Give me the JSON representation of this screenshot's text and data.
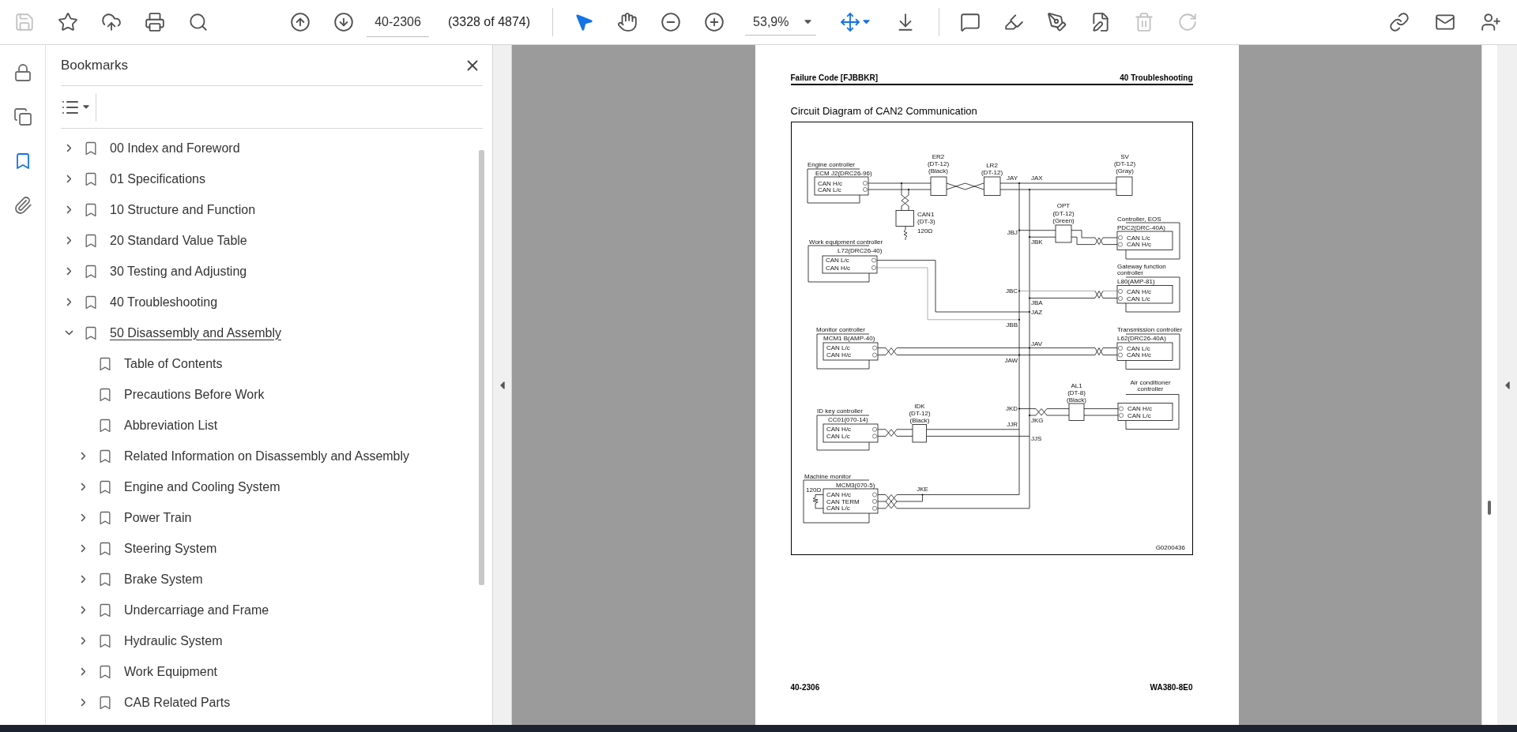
{
  "toolbar": {
    "tools": [
      {
        "disabled": true
      },
      {
        "disabled": false
      },
      {
        "disabled": false
      },
      {
        "disabled": false
      },
      {
        "disabled": false
      },
      {
        "disabled": false
      },
      {
        "disabled": false
      },
      {
        "disabled": false
      },
      {
        "disabled": false
      },
      {
        "disabled": false
      },
      {
        "disabled": false
      },
      {
        "disabled": false
      },
      {
        "disabled": false
      },
      {
        "disabled": false
      },
      {
        "disabled": false
      },
      {
        "disabled": true
      },
      {
        "disabled": true
      },
      {
        "disabled": false
      },
      {
        "disabled": false
      },
      {
        "disabled": false
      }
    ],
    "mode_tools": [
      {
        "selected": true
      },
      {
        "selected": false
      }
    ],
    "page_field": {
      "value": "40-2306"
    },
    "page_count": "(3328 of 4874)",
    "zoom_field": {
      "value": "53,9%"
    }
  },
  "side_rail": [
    {
      "selected": false
    },
    {
      "selected": false
    },
    {
      "selected": true
    },
    {
      "selected": false
    }
  ],
  "bookmarks": {
    "title": "Bookmarks",
    "items": [
      {
        "label": "00 Index and Foreword",
        "expandable": true,
        "expanded": false,
        "selected": false
      },
      {
        "label": "01 Specifications",
        "expandable": true,
        "expanded": false,
        "selected": false
      },
      {
        "label": "10 Structure and Function",
        "expandable": true,
        "expanded": false,
        "selected": false
      },
      {
        "label": "20 Standard Value Table",
        "expandable": true,
        "expanded": false,
        "selected": false
      },
      {
        "label": "30 Testing and Adjusting",
        "expandable": true,
        "expanded": false,
        "selected": false
      },
      {
        "label": "40 Troubleshooting",
        "expandable": true,
        "expanded": false,
        "selected": false
      },
      {
        "label": "50 Disassembly and Assembly",
        "expandable": true,
        "expanded": true,
        "selected": true,
        "children": [
          {
            "label": "Table of Contents",
            "expandable": false,
            "expanded": false,
            "selected": false
          },
          {
            "label": "Precautions Before Work",
            "expandable": false,
            "expanded": false,
            "selected": false
          },
          {
            "label": "Abbreviation List",
            "expandable": false,
            "expanded": false,
            "selected": false
          },
          {
            "label": "Related Information on Disassembly and Assembly",
            "expandable": true,
            "expanded": false,
            "selected": false
          },
          {
            "label": "Engine and Cooling System",
            "expandable": true,
            "expanded": false,
            "selected": false
          },
          {
            "label": "Power Train",
            "expandable": true,
            "expanded": false,
            "selected": false
          },
          {
            "label": "Steering System",
            "expandable": true,
            "expanded": false,
            "selected": false
          },
          {
            "label": "Brake System",
            "expandable": true,
            "expanded": false,
            "selected": false
          },
          {
            "label": "Undercarriage and Frame",
            "expandable": true,
            "expanded": false,
            "selected": false
          },
          {
            "label": "Hydraulic System",
            "expandable": true,
            "expanded": false,
            "selected": false
          },
          {
            "label": "Work Equipment",
            "expandable": true,
            "expanded": false,
            "selected": false
          },
          {
            "label": "CAB Related Parts",
            "expandable": true,
            "expanded": false,
            "selected": false
          }
        ]
      }
    ]
  },
  "page": {
    "header_left": "Failure Code [FJBBKR]",
    "header_right": "40 Troubleshooting",
    "title": "Circuit Diagram of CAN2 Communication",
    "diagram": {
      "devices": [
        {
          "title": [
            "Engine controller"
          ],
          "connector": "ECM J2(DRC26-96)",
          "lines": [
            "CAN H/c",
            "CAN L/c"
          ]
        },
        {
          "title": [
            "Work equipment controller"
          ],
          "connector": "L72(DRC26-40)",
          "lines": [
            "CAN L/c",
            "CAN H/c"
          ]
        },
        {
          "title": [
            "Monitor controller"
          ],
          "connector": "MCM1 B(AMP-40)",
          "lines": [
            "CAN L/c",
            "CAN H/c"
          ]
        },
        {
          "title": [
            "ID key controller"
          ],
          "connector": "CC01(070-14)",
          "lines": [
            "CAN H/c",
            "CAN L/c"
          ]
        },
        {
          "title": [
            "Machine monitor"
          ],
          "connector": "MCM3(070-5)",
          "resistor": "120Ω",
          "lines": [
            "CAN H/c",
            "CAN TERM",
            "CAN L/c"
          ]
        },
        {
          "title": [
            "Controller, EOS"
          ],
          "connector": "PDC2(DRC-40A)",
          "lines": [
            "CAN L/c",
            "CAN H/c"
          ]
        },
        {
          "title": [
            "Gateway function",
            "controller"
          ],
          "connector": "L80(AMP-81)",
          "lines": [
            "CAN H/c",
            "CAN L/c"
          ]
        },
        {
          "title": [
            "Transmission controller"
          ],
          "connector": "L62(DRC26-40A)",
          "lines": [
            "CAN L/c",
            "CAN H/c"
          ]
        },
        {
          "title": [
            "Air conditioner",
            "controller"
          ],
          "lines": [
            "CAN H/c",
            "CAN L/c"
          ]
        }
      ],
      "connectors": [
        {
          "labels": [
            "ER2",
            "(DT-12)",
            "(Black)"
          ]
        },
        {
          "labels": [
            "LR2",
            "(DT-12)"
          ]
        },
        {
          "labels": [
            "SV",
            "(DT-12)",
            "(Gray)"
          ]
        },
        {
          "labels": [
            "CAN1",
            "(DT-3)",
            "120Ω"
          ]
        },
        {
          "labels": [
            "OPT",
            "(DT-12)",
            "(Green)"
          ]
        },
        {
          "labels": [
            "IDK",
            "(DT-12)",
            "(Black)"
          ]
        },
        {
          "labels": [
            "AL1",
            "(DT-8)",
            "(Black)"
          ]
        }
      ],
      "junctions": [
        "JAY",
        "JAX",
        "JBJ",
        "JBK",
        "JBC",
        "JBA",
        "JAZ",
        "JBB",
        "JAV",
        "JAW",
        "JKD",
        "JKG",
        "JJR",
        "JJS",
        "JKE"
      ],
      "drawing_code": "G0200436"
    },
    "footer_left": "40-2306",
    "footer_right": "WA380-8E0"
  }
}
